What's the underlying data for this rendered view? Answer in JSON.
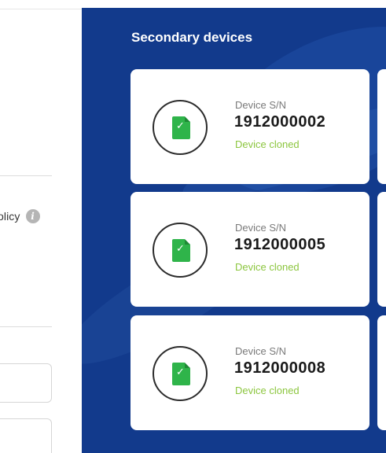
{
  "left_pane": {
    "policy_text": "olicy",
    "info_icon": "info-icon"
  },
  "secondary_devices": {
    "title": "Secondary devices",
    "devices": [
      {
        "label": "Device S/N",
        "serial": "1912000002",
        "status": "Device cloned",
        "icon": "document-check-icon"
      },
      {
        "label": "Device S/N",
        "serial": "1912000005",
        "status": "Device cloned",
        "icon": "document-check-icon"
      },
      {
        "label": "Device S/N",
        "serial": "1912000008",
        "status": "Device cloned",
        "icon": "document-check-icon"
      }
    ]
  },
  "colors": {
    "panel_background": "#123a8c",
    "status_green": "#8cc63f",
    "icon_green": "#2fb44a"
  }
}
